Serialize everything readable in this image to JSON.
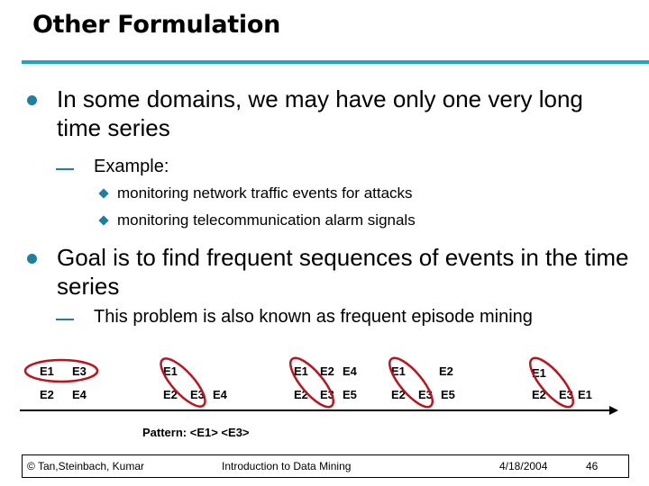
{
  "slide": {
    "title": "Other Formulation",
    "bullets": [
      {
        "text": "In some domains, we may have only one very long time series",
        "sub": {
          "text": "Example:",
          "items": [
            "monitoring network traffic events for attacks",
            "monitoring telecommunication alarm signals"
          ]
        }
      },
      {
        "text": "Goal is to find frequent sequences of events in the time series",
        "sub": {
          "text": "This problem is also known as frequent episode mining"
        }
      }
    ],
    "colors": {
      "title_rule": "#1fa3c6",
      "bullet": "#1f7f9f",
      "oval": "#c0121c"
    }
  },
  "diagram": {
    "windows": [
      {
        "top": [
          "E1",
          "E3"
        ],
        "bottom": [
          "E2",
          "E4"
        ]
      },
      {
        "top": [
          "E1"
        ],
        "bottom": [
          "E2",
          "E3",
          "E4"
        ]
      },
      {
        "top": [
          "E1",
          "E2",
          "E4"
        ],
        "bottom": [
          "E2",
          "E3",
          "E5"
        ]
      },
      {
        "top": [
          "E1",
          "E2"
        ],
        "bottom": [
          "E2",
          "E3",
          "E5"
        ]
      },
      {
        "top": [
          "E1"
        ],
        "bottom": [
          "E2",
          "E3",
          "E1"
        ]
      }
    ],
    "pattern_label": "Pattern: <E1> <E3>"
  },
  "footer": {
    "copyright": "© Tan,Steinbach, Kumar",
    "course": "Introduction to Data Mining",
    "date": "4/18/2004",
    "page": "46"
  }
}
